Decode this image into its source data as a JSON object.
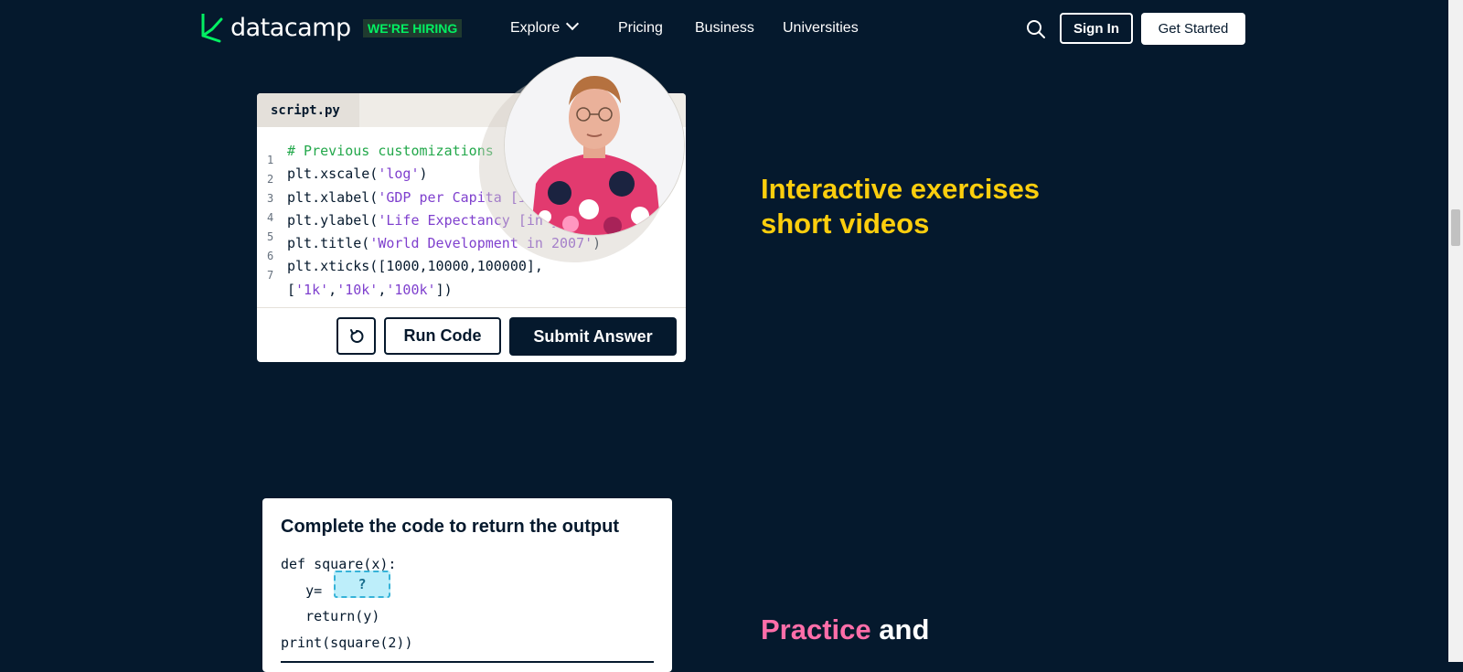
{
  "nav": {
    "logo_text": "datacamp",
    "hiring_badge": "WE'RE HIRING",
    "links": [
      {
        "label": "Explore"
      },
      {
        "label": "Pricing"
      },
      {
        "label": "Business"
      },
      {
        "label": "Universities"
      }
    ],
    "sign_in": "Sign In",
    "get_started": "Get Started",
    "search_icon": "search-icon"
  },
  "code_editor": {
    "tab": "script.py",
    "line_numbers": [
      "1",
      "2",
      "3",
      "4",
      "5",
      "6",
      "7"
    ],
    "lines": [
      [
        {
          "t": "# Previous customizations",
          "k": "com"
        }
      ],
      [
        {
          "t": "plt.xscale(",
          "k": ""
        },
        {
          "t": "'log'",
          "k": "str"
        },
        {
          "t": ")",
          "k": ""
        }
      ],
      [
        {
          "t": "plt.xlabel(",
          "k": ""
        },
        {
          "t": "'GDP per Capita [in USD]'",
          "k": "str"
        },
        {
          "t": ")",
          "k": ""
        }
      ],
      [
        {
          "t": "plt.ylabel(",
          "k": ""
        },
        {
          "t": "'Life Expectancy [in years]'",
          "k": "str"
        },
        {
          "t": ")",
          "k": ""
        }
      ],
      [
        {
          "t": "plt.title(",
          "k": ""
        },
        {
          "t": "'World Development in 2007'",
          "k": "str"
        },
        {
          "t": ")",
          "k": ""
        }
      ],
      [
        {
          "t": "plt.xticks([1000,10000,100000],",
          "k": ""
        }
      ],
      [
        {
          "t": "[",
          "k": ""
        },
        {
          "t": "'1k'",
          "k": "str"
        },
        {
          "t": ",",
          "k": ""
        },
        {
          "t": "'10k'",
          "k": "str"
        },
        {
          "t": ",",
          "k": ""
        },
        {
          "t": "'100k'",
          "k": "str"
        },
        {
          "t": "])",
          "k": ""
        }
      ]
    ],
    "reset_icon": "reset-icon",
    "run_label": "Run Code",
    "submit_label": "Submit Answer"
  },
  "sections": {
    "interactive": {
      "line1": "Interactive exercises",
      "line2": "short videos"
    },
    "practice": {
      "word1": "Practice",
      "word2": "and"
    }
  },
  "quiz": {
    "title": "Complete the code to return the output",
    "code": [
      "def square(x):",
      "   y=",
      "   return(y)",
      "print(square(2))"
    ],
    "blank": "?"
  },
  "colors": {
    "background": "#05192d",
    "accent_green": "#03ef62",
    "heading_yellow": "#fcce0d",
    "heading_pink": "#ff6ea9",
    "code_comment": "#23a84b",
    "code_string": "#7f40ce"
  }
}
